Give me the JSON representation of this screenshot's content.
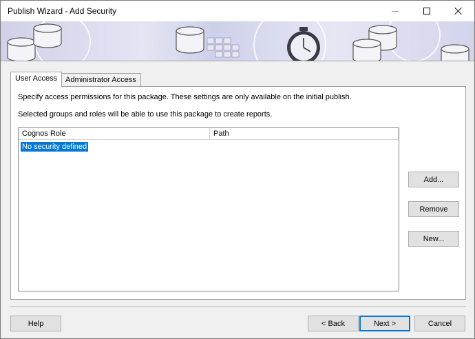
{
  "window": {
    "title": "Publish Wizard - Add Security"
  },
  "tabs": [
    {
      "label": "User Access",
      "active": true
    },
    {
      "label": "Administrator Access",
      "active": false
    }
  ],
  "panel": {
    "description_1": "Specify access permissions for this package.  These settings are only available on the initial publish.",
    "description_2": "Selected groups and roles will be able to use this package to create reports."
  },
  "list": {
    "columns": [
      "Cognos Role",
      "Path"
    ],
    "items": [
      {
        "role": "No security defined",
        "path": "",
        "selected": true
      }
    ]
  },
  "side_buttons": {
    "add": "Add...",
    "remove": "Remove",
    "new": "New..."
  },
  "footer_buttons": {
    "help": "Help",
    "back": "< Back",
    "next": "Next >",
    "cancel": "Cancel"
  },
  "colors": {
    "selection": "#0078d7",
    "banner": "#d6d8ee"
  }
}
